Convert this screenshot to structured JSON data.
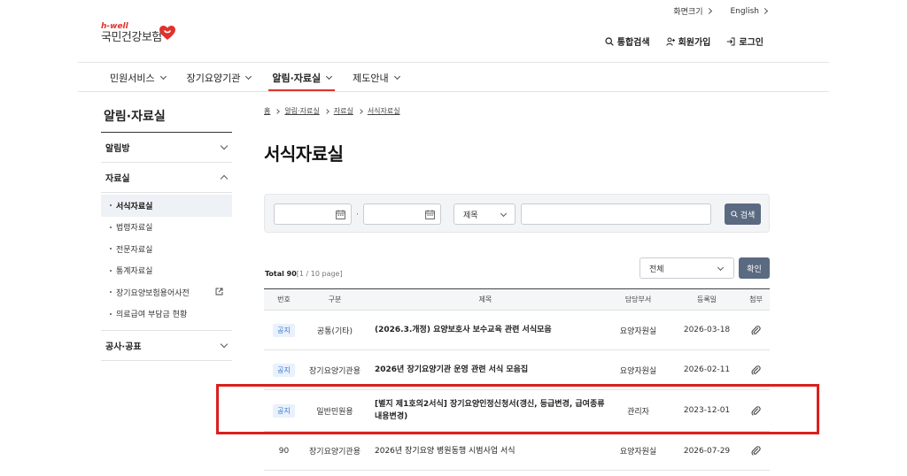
{
  "utility": {
    "font_size": "화면크기",
    "language": "English"
  },
  "logo": {
    "sub": "h-well",
    "main": "국민건강보험"
  },
  "header": {
    "search": "통합검색",
    "signup": "회원가입",
    "login": "로그인"
  },
  "gnb": [
    {
      "label": "민원서비스"
    },
    {
      "label": "장기요양기관"
    },
    {
      "label": "알림·자료실"
    },
    {
      "label": "제도안내"
    }
  ],
  "sidebar": {
    "title": "알림·자료실",
    "sections": [
      {
        "label": "알림방"
      },
      {
        "label": "자료실"
      },
      {
        "label": "공사·공표"
      }
    ],
    "sub_items": [
      {
        "label": "서식자료실"
      },
      {
        "label": "법령자료실"
      },
      {
        "label": "전문자료실"
      },
      {
        "label": "통계자료실"
      },
      {
        "label": "장기요양보험용어사전"
      },
      {
        "label": "의료급여 부담금 현황"
      }
    ]
  },
  "breadcrumb": [
    "홈",
    "알림·자료실",
    "자료실",
    "서식자료실"
  ],
  "page_title": "서식자료실",
  "search": {
    "select": "제목",
    "button": "검색"
  },
  "list": {
    "total_label": "Total 90",
    "page_info": "[1 / 10 page]",
    "filter": "전체",
    "confirm": "확인"
  },
  "table": {
    "headers": [
      "번호",
      "구분",
      "제목",
      "담당부서",
      "등록일",
      "첨부"
    ],
    "rows": [
      {
        "no": "공지",
        "category": "공통(기타)",
        "title": "(2026.3.개정) 요양보호사 보수교육 관련 서식모음",
        "dept": "요양자원실",
        "date": "2026-03-18"
      },
      {
        "no": "공지",
        "category": "장기요양기관용",
        "title": "2026년 장기요양기관 운영 관련 서식 모음집",
        "dept": "요양자원실",
        "date": "2026-02-11"
      },
      {
        "no": "공지",
        "category": "일반민원용",
        "title": "[별지 제1호의2서식] 장기요양인정신청서(갱신, 등급변경, 급여종류 내용변경)",
        "dept": "관리자",
        "date": "2023-12-01"
      },
      {
        "no": "90",
        "category": "장기요양기관용",
        "title": "2026년 장기요양 병원동행 시범사업 서식",
        "dept": "요양자원실",
        "date": "2026-07-29"
      }
    ]
  },
  "colors": {
    "accent": "#e0322d",
    "button": "#5a6a80",
    "badge_bg": "#e8f1fc",
    "badge_text": "#3a78c9"
  }
}
